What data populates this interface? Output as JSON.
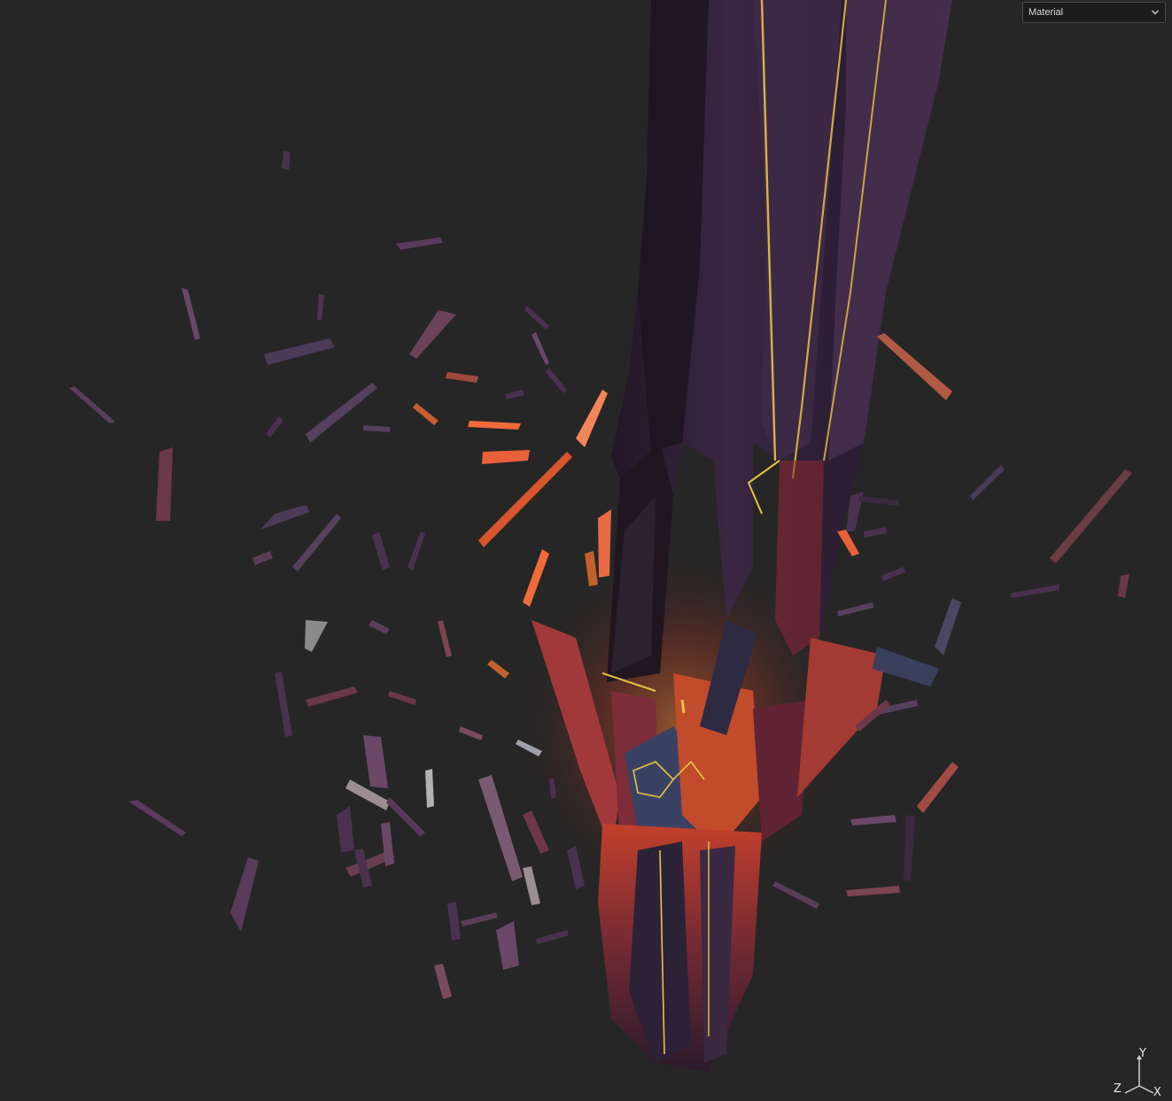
{
  "toolbar": {
    "render_mode": "Material",
    "render_mode_icon": "chevron-down-icon"
  },
  "axis_gizmo": {
    "y_label": "Y",
    "z_label": "Z",
    "x_label": "X"
  },
  "scene": {
    "background_color": "#262626",
    "crystal_color": "#3a2138",
    "ember_color": "#e8603a",
    "glow_color": "#e7c341"
  }
}
